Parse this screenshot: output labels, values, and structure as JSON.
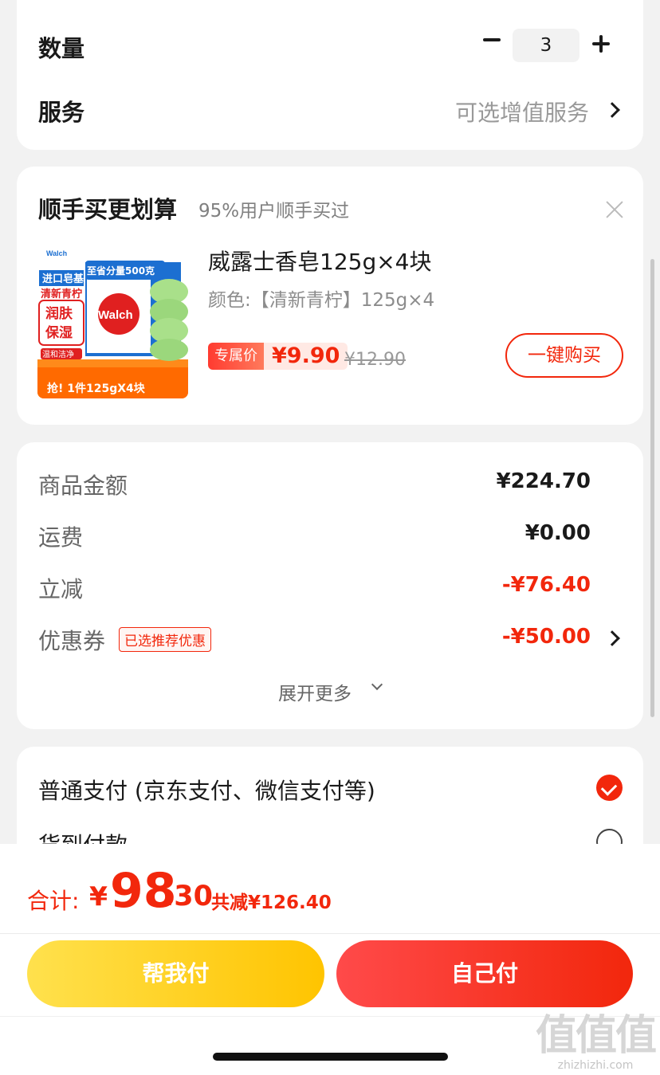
{
  "quantity_section": {
    "qty_label": "数量",
    "qty_value": "3",
    "service_label": "服务",
    "service_value": "可选增值服务"
  },
  "addon_section": {
    "title": "顺手买更划算",
    "subtitle": "95%用户顺手买过",
    "product": {
      "name": "威露士香皂125g×4块",
      "spec": "颜色:【清新青柠】125g×4",
      "tag_label": "专属价",
      "price": "¥9.90",
      "original_price": "¥12.90",
      "buy_button": "一键购买",
      "image_texts": {
        "brand": "Walch",
        "line1": "进口皂基",
        "line2": "清新青柠",
        "badge": "至省分量500克",
        "b1": "润肤",
        "b2": "保湿",
        "b3": "温和洁净",
        "bottom": "抢! 1件125gX4块"
      }
    }
  },
  "amount_section": {
    "rows": [
      {
        "label": "商品金额",
        "value": "¥224.70"
      },
      {
        "label": "运费",
        "value": "¥0.00"
      },
      {
        "label": "立减",
        "value": "-¥76.40"
      },
      {
        "label": "优惠券",
        "value": "-¥50.00",
        "badge": "已选推荐优惠"
      }
    ],
    "expand_label": "展开更多"
  },
  "payment_section": {
    "options": [
      {
        "label": "普通支付 (京东支付、微信支付等)",
        "selected": true
      },
      {
        "label": "货到付款",
        "selected": false
      }
    ]
  },
  "bottom_bar": {
    "total_label": "合计:",
    "currency": "¥",
    "total_integer": "98",
    "total_decimal": ".30",
    "saved_text": "共减¥126.40",
    "help_pay_button": "帮我付",
    "self_pay_button": "自己付"
  },
  "watermark": {
    "big": "值值值",
    "small": "zhizhizhi.com"
  },
  "colors": {
    "accent_red": "#f2270c",
    "help_yellow": "#ffc400"
  }
}
